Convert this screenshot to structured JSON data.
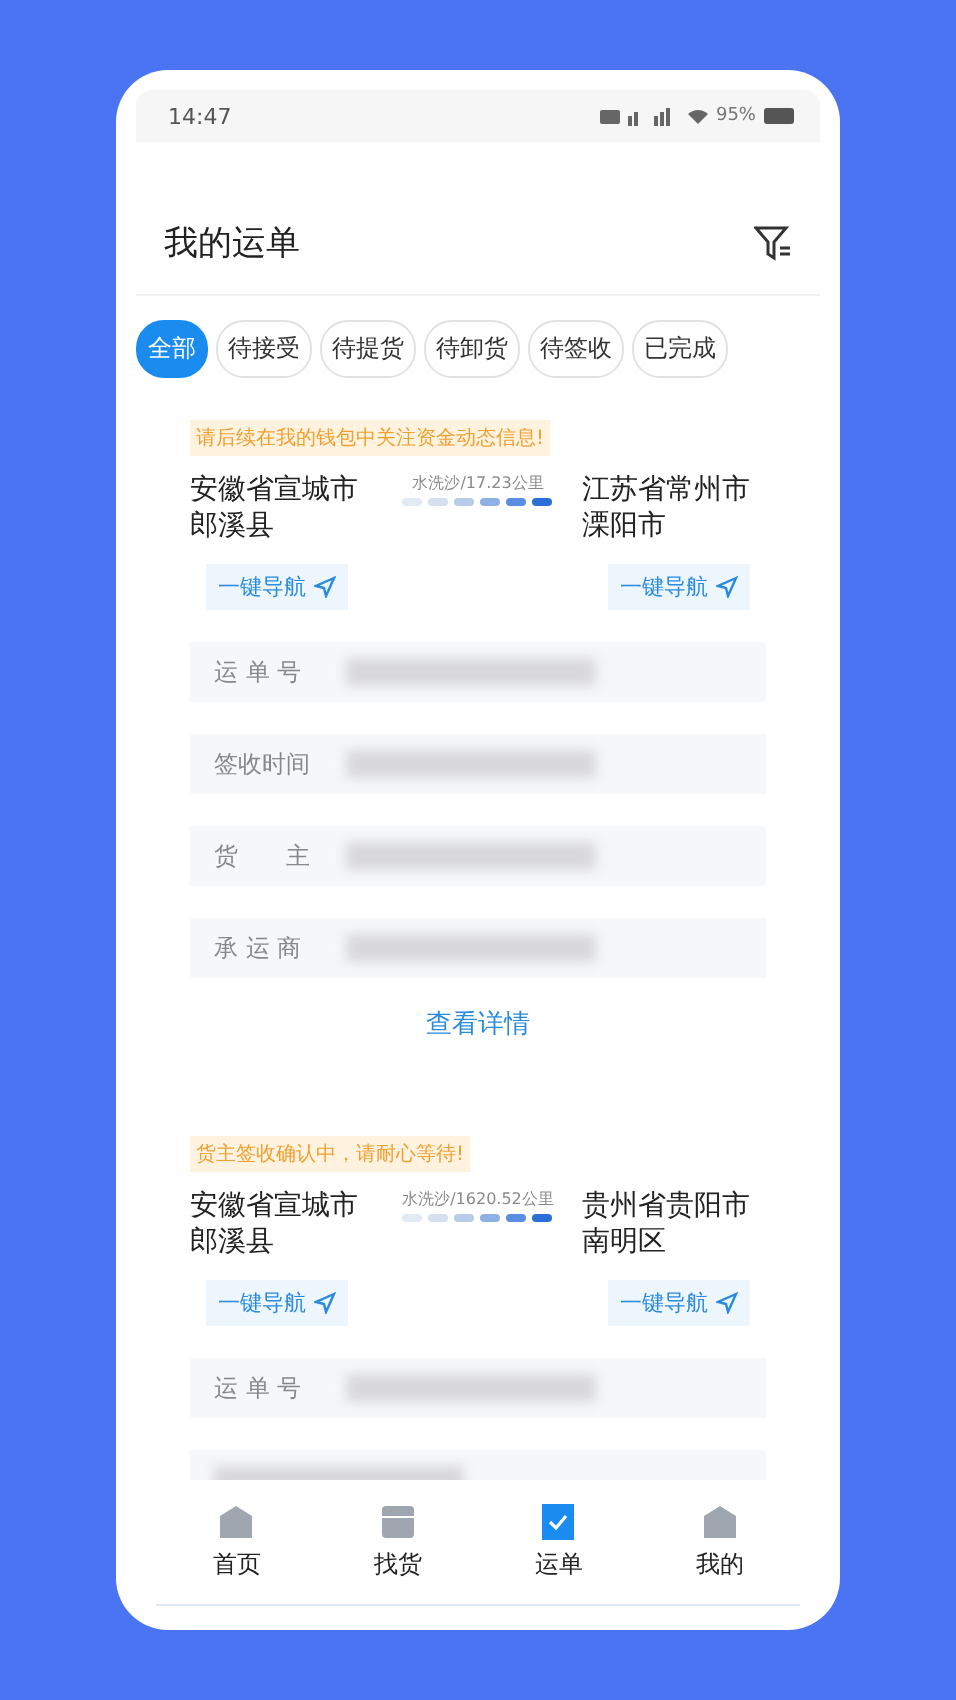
{
  "status_bar": {
    "time": "14:47",
    "battery": "95%"
  },
  "header": {
    "title": "我的运单"
  },
  "tabs": [
    {
      "label": "全部",
      "selected": true
    },
    {
      "label": "待接受",
      "selected": false
    },
    {
      "label": "待提货",
      "selected": false
    },
    {
      "label": "待卸货",
      "selected": false
    },
    {
      "label": "待签收",
      "selected": false
    },
    {
      "label": "已完成",
      "selected": false
    }
  ],
  "orders": [
    {
      "notice": "请后续在我的钱包中关注资金动态信息!",
      "origin": "安徽省宣城市郎溪县",
      "destination": "江苏省常州市溧阳市",
      "route": "水洗沙/17.23公里",
      "nav_labels": [
        "一键导航",
        "一键导航"
      ],
      "fields": [
        {
          "label": "运 单 号"
        },
        {
          "label": "签收时间"
        },
        {
          "label": "货　　主"
        },
        {
          "label": "承 运 商"
        }
      ],
      "details_link": "查看详情"
    },
    {
      "notice": "货主签收确认中，请耐心等待!",
      "origin": "安徽省宣城市郎溪县",
      "destination": "贵州省贵阳市南明区",
      "route": "水洗沙/1620.52公里",
      "nav_labels": [
        "一键导航",
        "一键导航"
      ],
      "fields": [
        {
          "label": "运 单 号"
        }
      ]
    }
  ],
  "bottom_nav": [
    {
      "label": "首页",
      "selected": false,
      "kind": "home"
    },
    {
      "label": "找货",
      "selected": false,
      "kind": "box"
    },
    {
      "label": "运单",
      "selected": true,
      "kind": "order"
    },
    {
      "label": "我的",
      "selected": false,
      "kind": "home"
    }
  ]
}
